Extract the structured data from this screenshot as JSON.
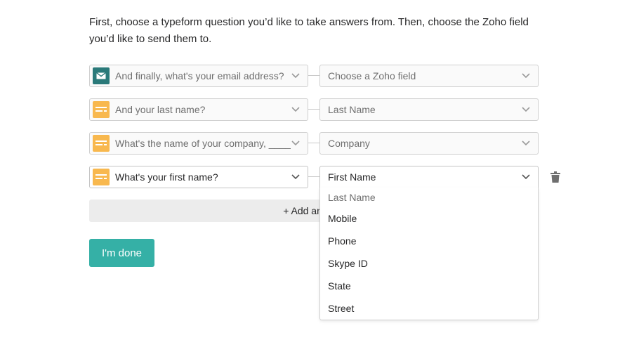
{
  "intro_text": "First, choose a typeform question you’d like to take answers from. Then, choose the Zoho field you’d like to send them to.",
  "rows": [
    {
      "question": "And finally, what's your email address?",
      "question_icon": "email-icon",
      "field": "Choose a Zoho field"
    },
    {
      "question": "And your last name?",
      "question_icon": "short-text-icon",
      "field": "Last Name"
    },
    {
      "question": "What's the name of your company, ____?",
      "question_icon": "short-text-icon",
      "field": "Company"
    },
    {
      "question": "What's your first name?",
      "question_icon": "short-text-icon",
      "field": "First Name"
    }
  ],
  "add_another_label": "+ Add another",
  "done_label": "I'm done",
  "dropdown_options": [
    "Last Name",
    "Mobile",
    "Phone",
    "Skype ID",
    "State",
    "Street"
  ],
  "colors": {
    "email_icon_bg": "#2b7a7a",
    "text_icon_bg": "#f8b84e",
    "done_button_bg": "#35b0a6"
  }
}
